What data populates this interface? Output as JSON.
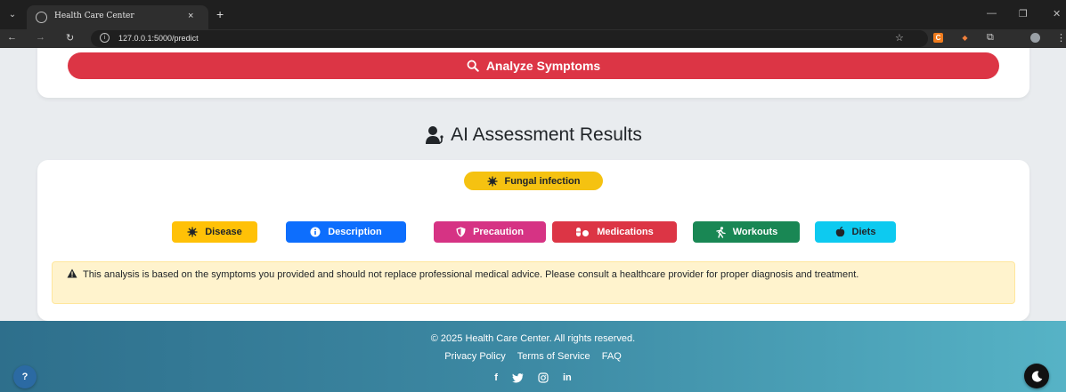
{
  "browser": {
    "tab_title": "Health Care Center",
    "close_glyph": "×",
    "new_tab_glyph": "+",
    "url": "127.0.0.1:5000/predict",
    "extension_c": "C"
  },
  "form": {
    "analyze_label": "Analyze Symptoms",
    "analyze_icon": "search-icon"
  },
  "results": {
    "title": "AI Assessment Results",
    "title_icon": "user-doctor-icon",
    "predicted_disease": "Fungal infection",
    "badge_icon": "virus-icon",
    "buttons": [
      {
        "label": "Disease",
        "icon": "virus-icon",
        "color": "#ffc107",
        "text_color": "#212529"
      },
      {
        "label": "Description",
        "icon": "info-icon",
        "color": "#0d6efd",
        "text_color": "#ffffff"
      },
      {
        "label": "Precaution",
        "icon": "shield-icon",
        "color": "#d63384",
        "text_color": "#ffffff"
      },
      {
        "label": "Medications",
        "icon": "pills-icon",
        "color": "#dc3545",
        "text_color": "#ffffff"
      },
      {
        "label": "Workouts",
        "icon": "running-icon",
        "color": "#198754",
        "text_color": "#ffffff"
      },
      {
        "label": "Diets",
        "icon": "apple-icon",
        "color": "#0dcaf0",
        "text_color": "#212529"
      }
    ],
    "disclaimer": "This analysis is based on the symptoms you provided and should not replace professional medical advice. Please consult a healthcare provider for proper diagnosis and treatment."
  },
  "footer": {
    "copyright": "© 2025 Health Care Center. All rights reserved.",
    "links": [
      "Privacy Policy",
      "Terms of Service",
      "FAQ"
    ],
    "social": [
      "f",
      "twitter-icon",
      "instagram-icon",
      "in"
    ],
    "help_label": "?"
  },
  "colors": {
    "danger": "#dc3545",
    "warning_bg": "#fff3cd",
    "footer_start": "#2e6f8c",
    "footer_end": "#56b3c6"
  }
}
